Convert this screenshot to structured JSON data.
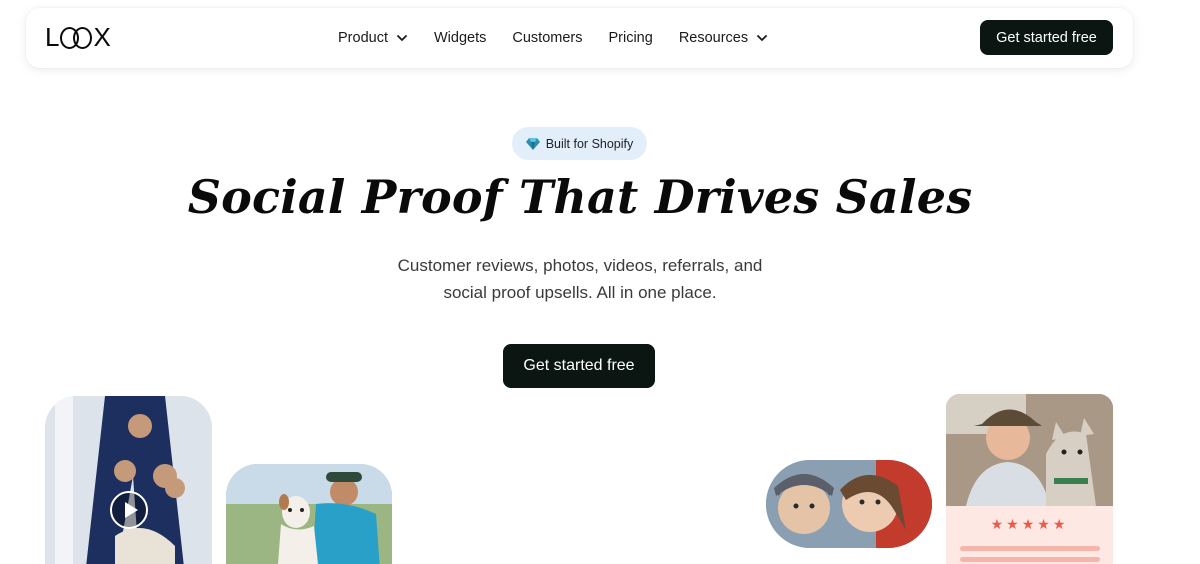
{
  "nav": {
    "logo": "LOOX",
    "links": [
      {
        "label": "Product",
        "has_dropdown": true
      },
      {
        "label": "Widgets",
        "has_dropdown": false
      },
      {
        "label": "Customers",
        "has_dropdown": false
      },
      {
        "label": "Pricing",
        "has_dropdown": false
      },
      {
        "label": "Resources",
        "has_dropdown": true
      }
    ],
    "cta": "Get started free"
  },
  "hero": {
    "badge": "Built for Shopify",
    "title": "Social Proof That Drives Sales",
    "subtitle_line1": "Customer reviews, photos, videos, referrals, and",
    "subtitle_line2": "social proof upsells. All in one place.",
    "cta": "Get started free"
  },
  "review_card": {
    "rating": 5,
    "stars": "★★★★★"
  },
  "colors": {
    "cta_bg": "#0b1512",
    "badge_bg": "#e3eefb",
    "star": "#ec5a4a",
    "review_bg": "#fde8e4"
  }
}
